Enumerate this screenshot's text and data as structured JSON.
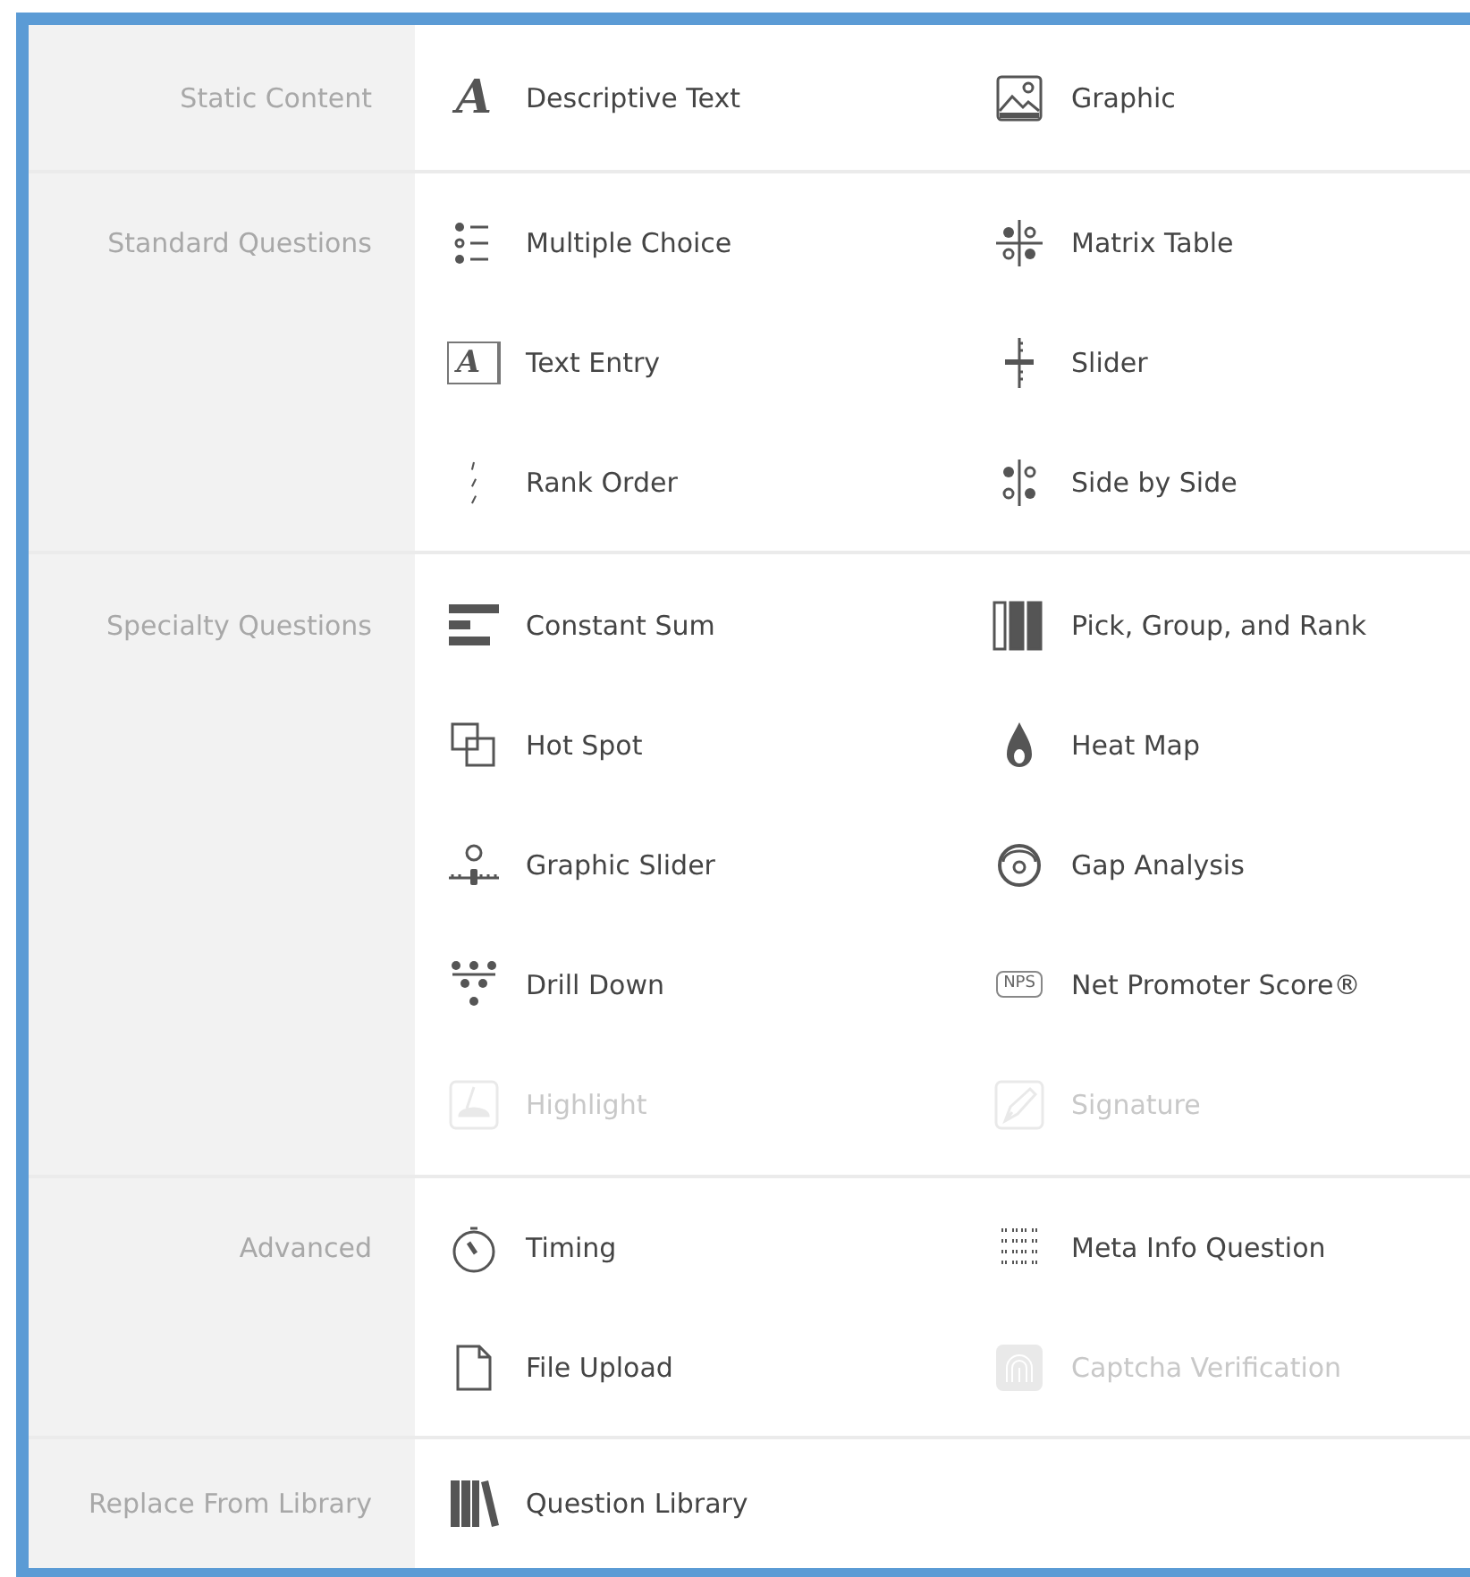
{
  "sections": [
    {
      "label": "Static Content",
      "items": [
        {
          "label": "Descriptive Text",
          "kind": "descriptive",
          "icon_text": "A",
          "disabled": false
        },
        {
          "label": "Graphic",
          "kind": "graphic",
          "disabled": false
        }
      ]
    },
    {
      "label": "Standard Questions",
      "items": [
        {
          "label": "Multiple Choice",
          "kind": "multiple",
          "disabled": false
        },
        {
          "label": "Matrix Table",
          "kind": "matrix",
          "disabled": false
        },
        {
          "label": "Text Entry",
          "kind": "textentry",
          "icon_text": "A",
          "disabled": false
        },
        {
          "label": "Slider",
          "kind": "slider",
          "disabled": false
        },
        {
          "label": "Rank Order",
          "kind": "rank",
          "disabled": false
        },
        {
          "label": "Side by Side",
          "kind": "sidebyside",
          "disabled": false
        }
      ]
    },
    {
      "label": "Specialty Questions",
      "items": [
        {
          "label": "Constant Sum",
          "kind": "constantsum",
          "disabled": false
        },
        {
          "label": "Pick, Group, and Rank",
          "kind": "pickgroup",
          "disabled": false
        },
        {
          "label": "Hot Spot",
          "kind": "hotspot",
          "disabled": false
        },
        {
          "label": "Heat Map",
          "kind": "heatmap",
          "disabled": false
        },
        {
          "label": "Graphic Slider",
          "kind": "graphicslider",
          "disabled": false
        },
        {
          "label": "Gap Analysis",
          "kind": "gap",
          "disabled": false
        },
        {
          "label": "Drill Down",
          "kind": "drilldown",
          "disabled": false
        },
        {
          "label": "Net Promoter Score®",
          "kind": "nps",
          "icon_text": "NPS",
          "disabled": false
        },
        {
          "label": "Highlight",
          "kind": "highlight",
          "disabled": true
        },
        {
          "label": "Signature",
          "kind": "signature",
          "disabled": true
        }
      ]
    },
    {
      "label": "Advanced",
      "items": [
        {
          "label": "Timing",
          "kind": "timing",
          "disabled": false
        },
        {
          "label": "Meta Info Question",
          "kind": "metainfo",
          "disabled": false
        },
        {
          "label": "File Upload",
          "kind": "fileupload",
          "disabled": false
        },
        {
          "label": "Captcha Verification",
          "kind": "captcha",
          "disabled": true
        }
      ]
    },
    {
      "label": "Replace From Library",
      "items": [
        {
          "label": "Question Library",
          "kind": "library",
          "disabled": false
        }
      ]
    }
  ]
}
